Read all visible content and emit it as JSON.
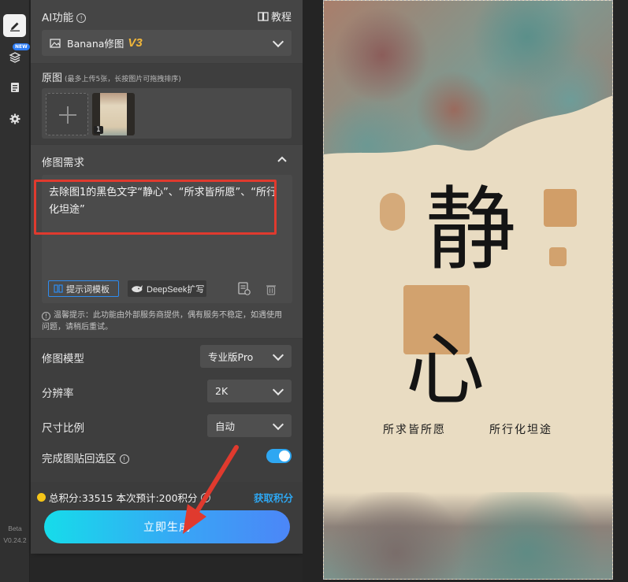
{
  "rail": {
    "items": [
      {
        "name": "edit",
        "icon": "pencil-icon",
        "active": true
      },
      {
        "name": "layers",
        "icon": "layers-icon",
        "badge": "NEW"
      },
      {
        "name": "notes",
        "icon": "clipboard-icon"
      },
      {
        "name": "settings",
        "icon": "gear-icon"
      }
    ],
    "beta_label": "Beta",
    "version": "V0.24.2"
  },
  "ai_section": {
    "title": "AI功能",
    "tutorial_label": "教程",
    "model_name": "Banana修图",
    "model_version": "V3"
  },
  "source": {
    "title": "原图",
    "hint": "(最多上传5张，长按图片可拖拽排序)",
    "thumb_index": "1"
  },
  "requirement": {
    "title": "修图需求",
    "text": "去除图1的黑色文字“静心”、“所求皆所愿”、“所行化坦途”",
    "template_button": "提示词模板",
    "deepseek_button": "DeepSeek扩写",
    "notice": "温馨提示：此功能由外部服务商提供，偶有服务不稳定，如遇使用问题，请稍后重试。"
  },
  "settings": {
    "model_label": "修图模型",
    "model_value": "专业版Pro",
    "resolution_label": "分辨率",
    "resolution_value": "2K",
    "ratio_label": "尺寸比例",
    "ratio_value": "自动",
    "paste_back_label": "完成图贴回选区",
    "paste_back_on": true
  },
  "footer": {
    "total_points": "总积分:33515",
    "estimate": "本次预计:200积分",
    "get_points": "获取积分",
    "generate_button": "立即生成"
  },
  "poster": {
    "big_char_1": "静",
    "big_char_2": "心",
    "line_1": "所求皆所愿",
    "line_2": "所行化坦途"
  },
  "colors": {
    "accent_blue": "#2ea7f2",
    "highlight_red": "#e03a2e",
    "v3_gold": "#f2b73a",
    "gradient_start": "#16dcea",
    "gradient_end": "#4c86f7"
  }
}
